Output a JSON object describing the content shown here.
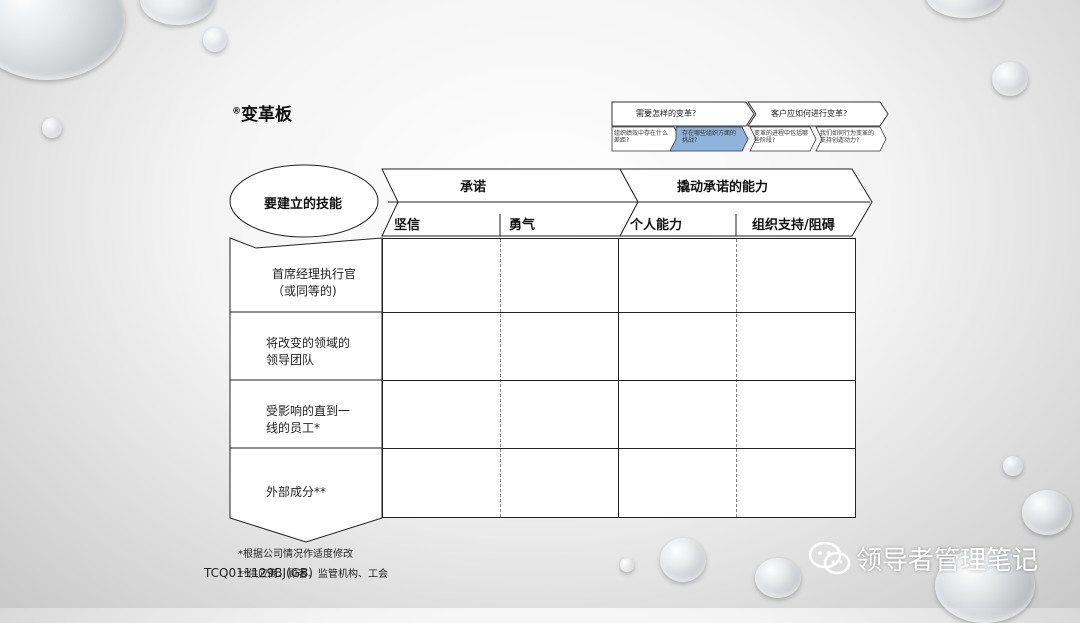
{
  "title": {
    "mark": "®",
    "text": "变革板"
  },
  "nav": {
    "q1": "需要怎样的变革?",
    "q2": "客户应如何进行变革?",
    "steps": [
      "组织绩效中存在什么差距?",
      "存在哪些组织方面的挑战?",
      "变革的进程中包括哪些阶段?",
      "我们如何行为变革的支持创造动力?"
    ]
  },
  "matrix": {
    "corner": "要建立的技能",
    "groups": [
      "承诺",
      "撬动承诺的能力"
    ],
    "columns": [
      "坚信",
      "勇气",
      "个人能力",
      "组织支持/阻碍"
    ],
    "rows": [
      "首席经理执行官（或同等的)",
      "将改变的领域的领导团队",
      "受影响的直到一线的员工*",
      "外部成分**"
    ]
  },
  "footnote": "*根据公司情况作适度修改",
  "footnote2": "**供应商、顾客、监管机构、工会",
  "doc_code": "TCQ011129BJ(GB)",
  "brand": "领导者管理笔记"
}
